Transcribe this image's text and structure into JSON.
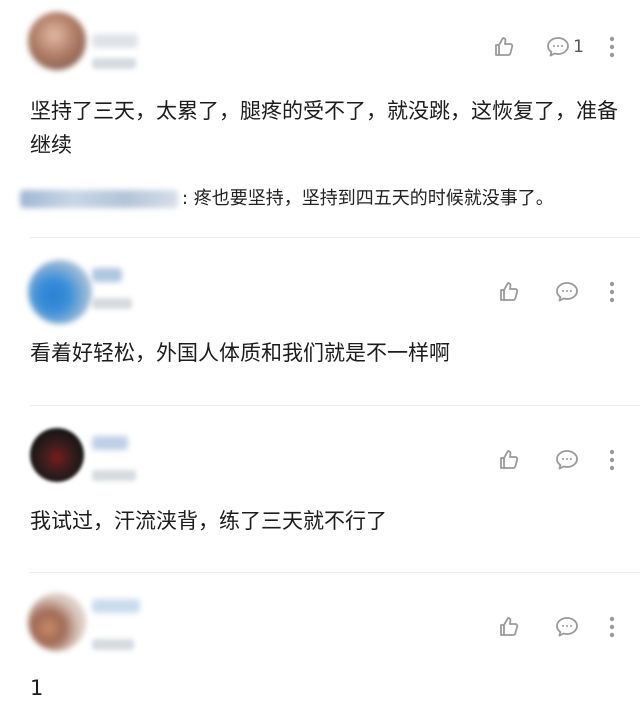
{
  "comments": [
    {
      "text": "坚持了三天，太累了，腿疼的受不了，就没跳，这恢复了，准备继续",
      "reply_count": "1",
      "sub_reply": {
        "text": ": 疼也要坚持，坚持到四五天的时候就没事了。"
      }
    },
    {
      "text": "看着好轻松，外国人体质和我们就是不一样啊"
    },
    {
      "text": "我试过，汗流浃背，练了三天就不行了"
    },
    {
      "text": "1"
    }
  ],
  "icons": {
    "like": "thumbs-up-icon",
    "reply": "comment-bubble-icon",
    "more": "more-vertical-icon"
  },
  "colors": {
    "icon": "#9a9a9a",
    "text": "#1c1c1c",
    "divider": "#ececec"
  }
}
